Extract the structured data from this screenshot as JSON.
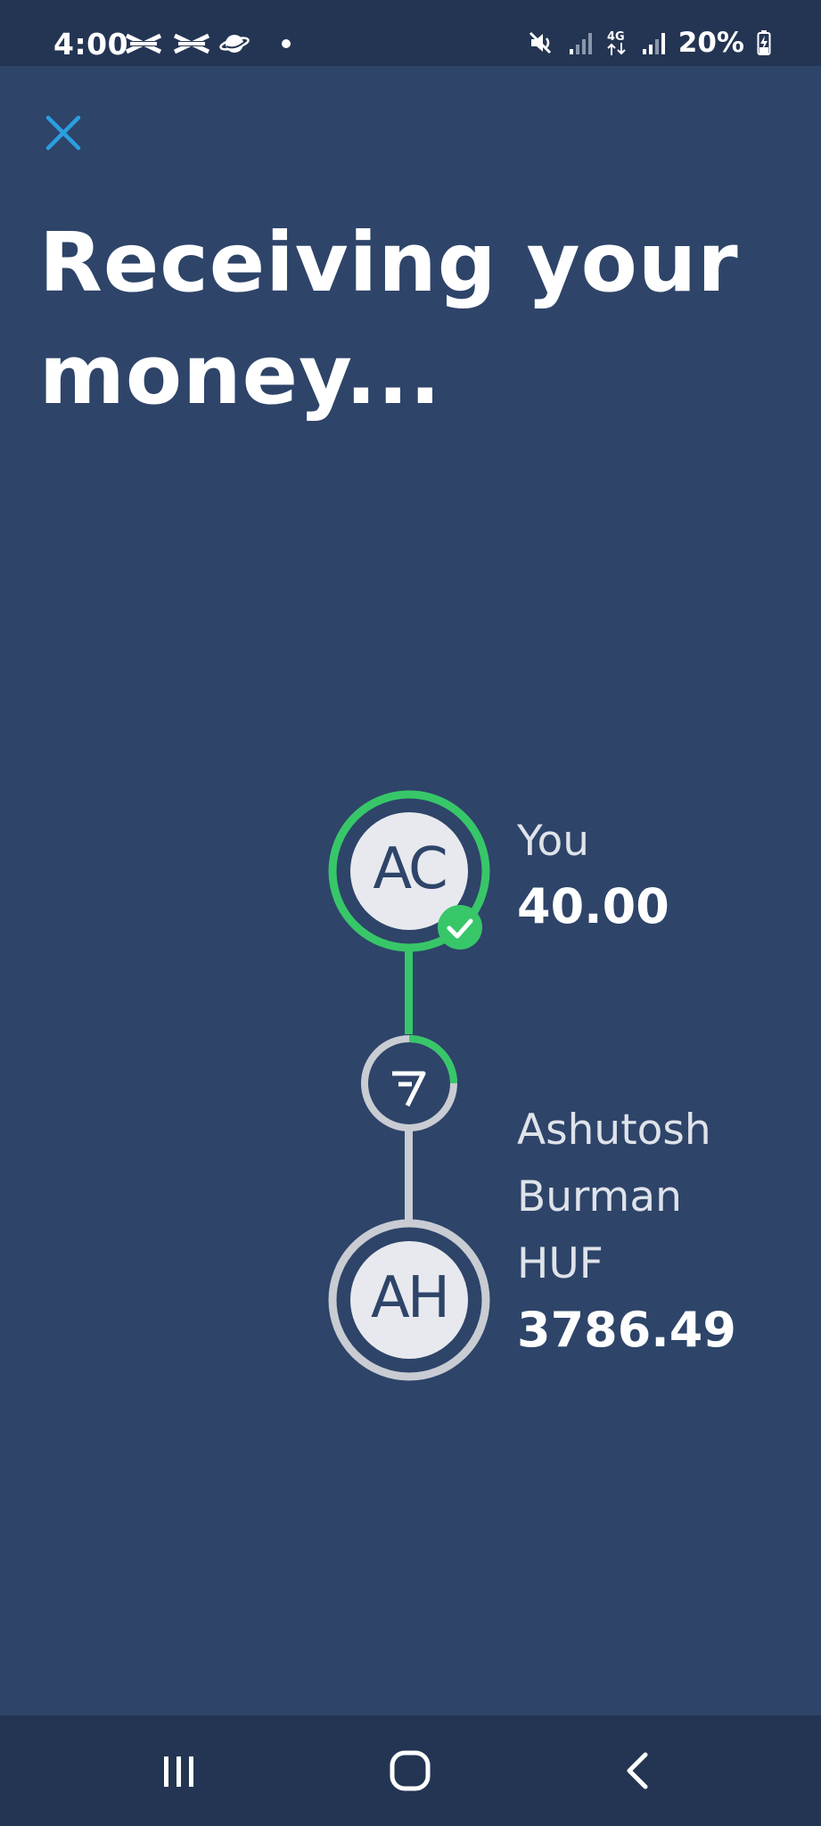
{
  "status_bar": {
    "time": "4:00",
    "battery": "20%",
    "network": "4G",
    "icons": [
      "halifax-icon",
      "halifax-icon",
      "planet-icon",
      "notification-dot",
      "mute-icon",
      "signal-icon",
      "signal-icon",
      "battery-charging-icon"
    ]
  },
  "header": {
    "close_icon": "close-icon",
    "title": "Receiving your money..."
  },
  "transfer": {
    "sender": {
      "initials": "AC",
      "label": "You",
      "amount": "40.00",
      "status": "complete"
    },
    "provider": {
      "icon": "wise-logo-icon",
      "progress": 0.25
    },
    "recipient": {
      "initials": "AH",
      "name_line1": "Ashutosh",
      "name_line2": "Burman",
      "currency": "HUF",
      "amount": "3786.49"
    }
  },
  "colors": {
    "background": "#2e4469",
    "bar": "#243553",
    "accent_green": "#37c769",
    "inactive_grey": "#c9ccd2",
    "close_blue": "#2a9fe0"
  },
  "nav_bar": {
    "recent": "recent-apps-icon",
    "home": "home-icon",
    "back": "back-icon"
  }
}
